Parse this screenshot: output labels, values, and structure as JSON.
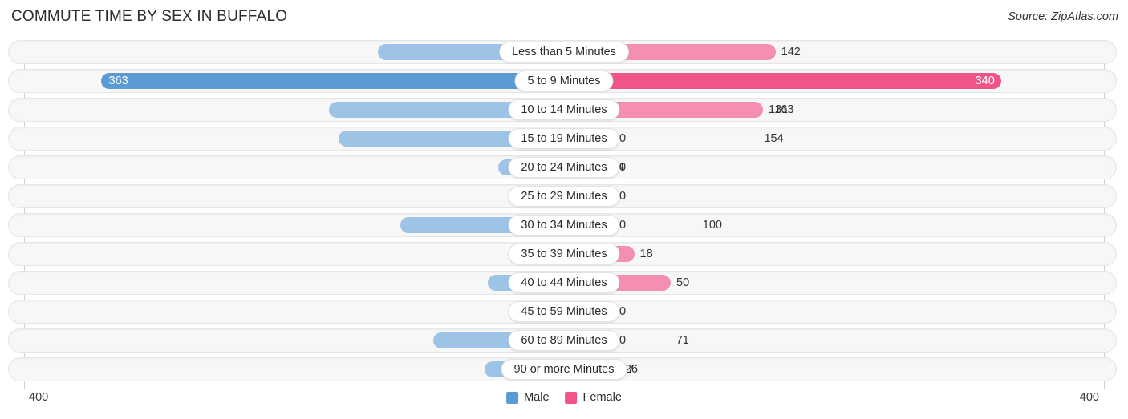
{
  "header": {
    "title": "COMMUTE TIME BY SEX IN BUFFALO",
    "source": "Source: ZipAtlas.com"
  },
  "axis": {
    "left_tick": "400",
    "right_tick": "400",
    "max": 400
  },
  "legend": {
    "items": [
      {
        "label": "Male",
        "color": "#5B9BD5"
      },
      {
        "label": "Female",
        "color": "#F0548A"
      }
    ]
  },
  "colors": {
    "male": "#9DC3E6",
    "male_max": "#5B9BD5",
    "female": "#F48FB1",
    "female_max": "#F0548A",
    "track": "#f7f7f7",
    "track_border": "#e6e6e6"
  },
  "chart_data": {
    "type": "bar",
    "title": "COMMUTE TIME BY SEX IN BUFFALO",
    "subtitle": "Source: ZipAtlas.com",
    "orientation": "horizontal",
    "layout": "diverging-bidirectional",
    "xlabel": "",
    "ylabel": "",
    "xlim": [
      400,
      400
    ],
    "grid": false,
    "legend_position": "bottom-center",
    "categories": [
      "Less than 5 Minutes",
      "5 to 9 Minutes",
      "10 to 14 Minutes",
      "15 to 19 Minutes",
      "20 to 24 Minutes",
      "25 to 29 Minutes",
      "30 to 34 Minutes",
      "35 to 39 Minutes",
      "40 to 44 Minutes",
      "45 to 59 Minutes",
      "60 to 89 Minutes",
      "90 or more Minutes"
    ],
    "series": [
      {
        "name": "Male",
        "direction": "left",
        "color": "#9DC3E6",
        "values": [
          120,
          363,
          163,
          154,
          14,
          0,
          100,
          0,
          23,
          0,
          71,
          26
        ]
      },
      {
        "name": "Female",
        "direction": "right",
        "color": "#F48FB1",
        "values": [
          142,
          340,
          131,
          0,
          0,
          0,
          0,
          18,
          50,
          0,
          0,
          7
        ]
      }
    ]
  },
  "rows": [
    {
      "label": "Less than 5 Minutes",
      "male": "120",
      "female": "142",
      "male_val": 120,
      "female_val": 142
    },
    {
      "label": "5 to 9 Minutes",
      "male": "363",
      "female": "340",
      "male_val": 363,
      "female_val": 340
    },
    {
      "label": "10 to 14 Minutes",
      "male": "163",
      "female": "131",
      "male_val": 163,
      "female_val": 131
    },
    {
      "label": "15 to 19 Minutes",
      "male": "154",
      "female": "0",
      "male_val": 154,
      "female_val": 0
    },
    {
      "label": "20 to 24 Minutes",
      "male": "14",
      "female": "0",
      "male_val": 14,
      "female_val": 0
    },
    {
      "label": "25 to 29 Minutes",
      "male": "0",
      "female": "0",
      "male_val": 0,
      "female_val": 0
    },
    {
      "label": "30 to 34 Minutes",
      "male": "100",
      "female": "0",
      "male_val": 100,
      "female_val": 0
    },
    {
      "label": "35 to 39 Minutes",
      "male": "0",
      "female": "18",
      "male_val": 0,
      "female_val": 18
    },
    {
      "label": "40 to 44 Minutes",
      "male": "23",
      "female": "50",
      "male_val": 23,
      "female_val": 50
    },
    {
      "label": "45 to 59 Minutes",
      "male": "0",
      "female": "0",
      "male_val": 0,
      "female_val": 0
    },
    {
      "label": "60 to 89 Minutes",
      "male": "71",
      "female": "0",
      "male_val": 71,
      "female_val": 0
    },
    {
      "label": "90 or more Minutes",
      "male": "26",
      "female": "7",
      "male_val": 26,
      "female_val": 7
    }
  ]
}
